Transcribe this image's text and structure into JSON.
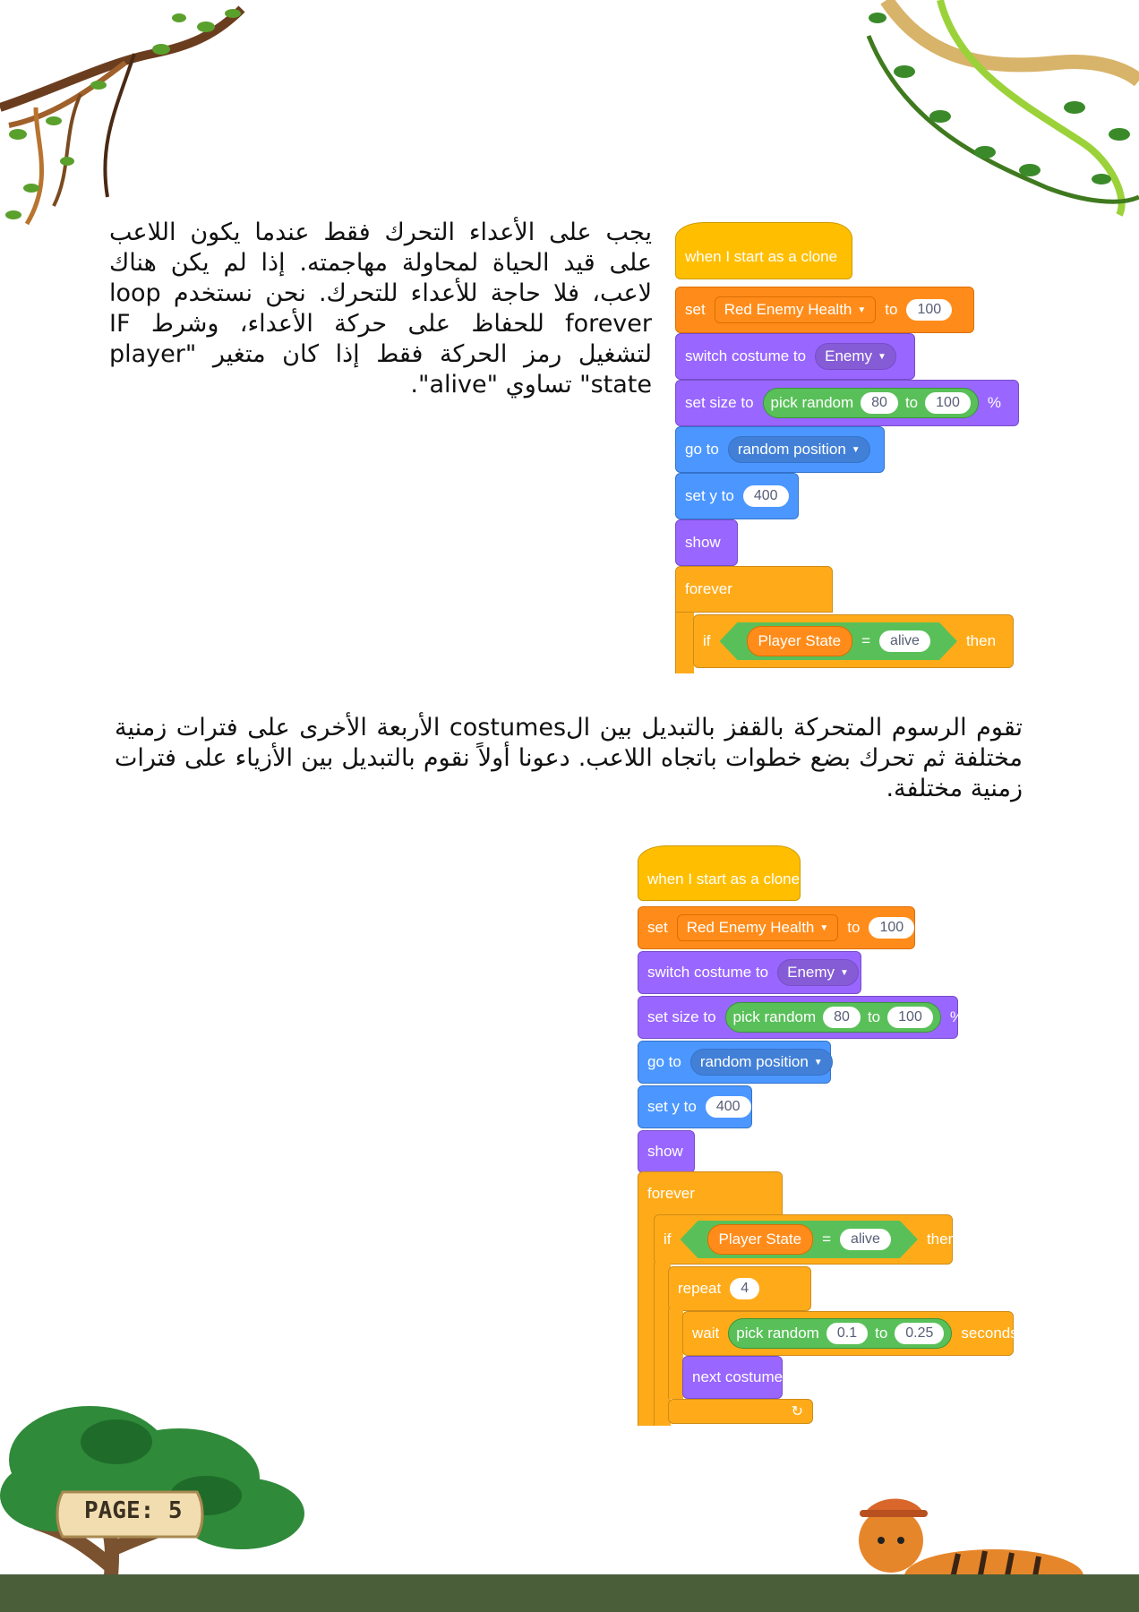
{
  "text": {
    "paragraph1": "يجب على الأعداء التحرك فقط عندما يكون اللاعب على قيد الحياة لمحاولة مهاجمته. إذا لم يكن هناك لاعب، فلا حاجة للأعداء للتحرك. نحن نستخدم loop forever للحفاظ على حركة الأعداء، وشرط IF لتشغيل رمز الحركة فقط إذا كان متغير \"player state\" تساوي \"alive\".",
    "paragraph2": "تقوم الرسوم المتحركة بالقفز بالتبديل بين الcostumes الأربعة الأخرى على فترات زمنية مختلفة ثم تحرك بضع خطوات باتجاه اللاعب. دعونا أولاً نقوم بالتبديل بين الأزياء على فترات زمنية مختلفة."
  },
  "code1": {
    "hat": "when I start as a clone",
    "set": "set",
    "set_var": "Red Enemy Health",
    "set_to": "to",
    "set_val": "100",
    "costume": "switch costume to",
    "costume_val": "Enemy",
    "size": "set size to",
    "random": "pick random",
    "rand_a": "80",
    "rand_to": "to",
    "rand_b": "100",
    "percent": "%",
    "goto": "go to",
    "goto_val": "random position",
    "sety": "set y to",
    "sety_val": "400",
    "show": "show",
    "forever": "forever",
    "if": "if",
    "state": "Player State",
    "eq": "=",
    "alive": "alive",
    "then": "then"
  },
  "code2": {
    "hat": "when I start as a clone",
    "set": "set",
    "set_var": "Red Enemy Health",
    "set_to": "to",
    "set_val": "100",
    "costume": "switch costume to",
    "costume_val": "Enemy",
    "size": "set size to",
    "random": "pick random",
    "rand_a": "80",
    "rand_to": "to",
    "rand_b": "100",
    "percent": "%",
    "goto": "go to",
    "goto_val": "random position",
    "sety": "set y to",
    "sety_val": "400",
    "show": "show",
    "forever": "forever",
    "if": "if",
    "state": "Player State",
    "eq": "=",
    "alive": "alive",
    "then": "then",
    "repeat": "repeat",
    "repeat_val": "4",
    "wait": "wait",
    "wait_random": "pick random",
    "wait_a": "0.1",
    "wait_to": "to",
    "wait_b": "0.25",
    "seconds": "seconds",
    "next": "next costume"
  },
  "page_label": "PAGE: 5",
  "colors": {
    "events": "#ffbf00",
    "variables": "#ff8c1a",
    "looks": "#9966ff",
    "motion": "#4c97ff",
    "control": "#ffab19",
    "operators": "#59c059",
    "ground": "#4a5e3a"
  }
}
